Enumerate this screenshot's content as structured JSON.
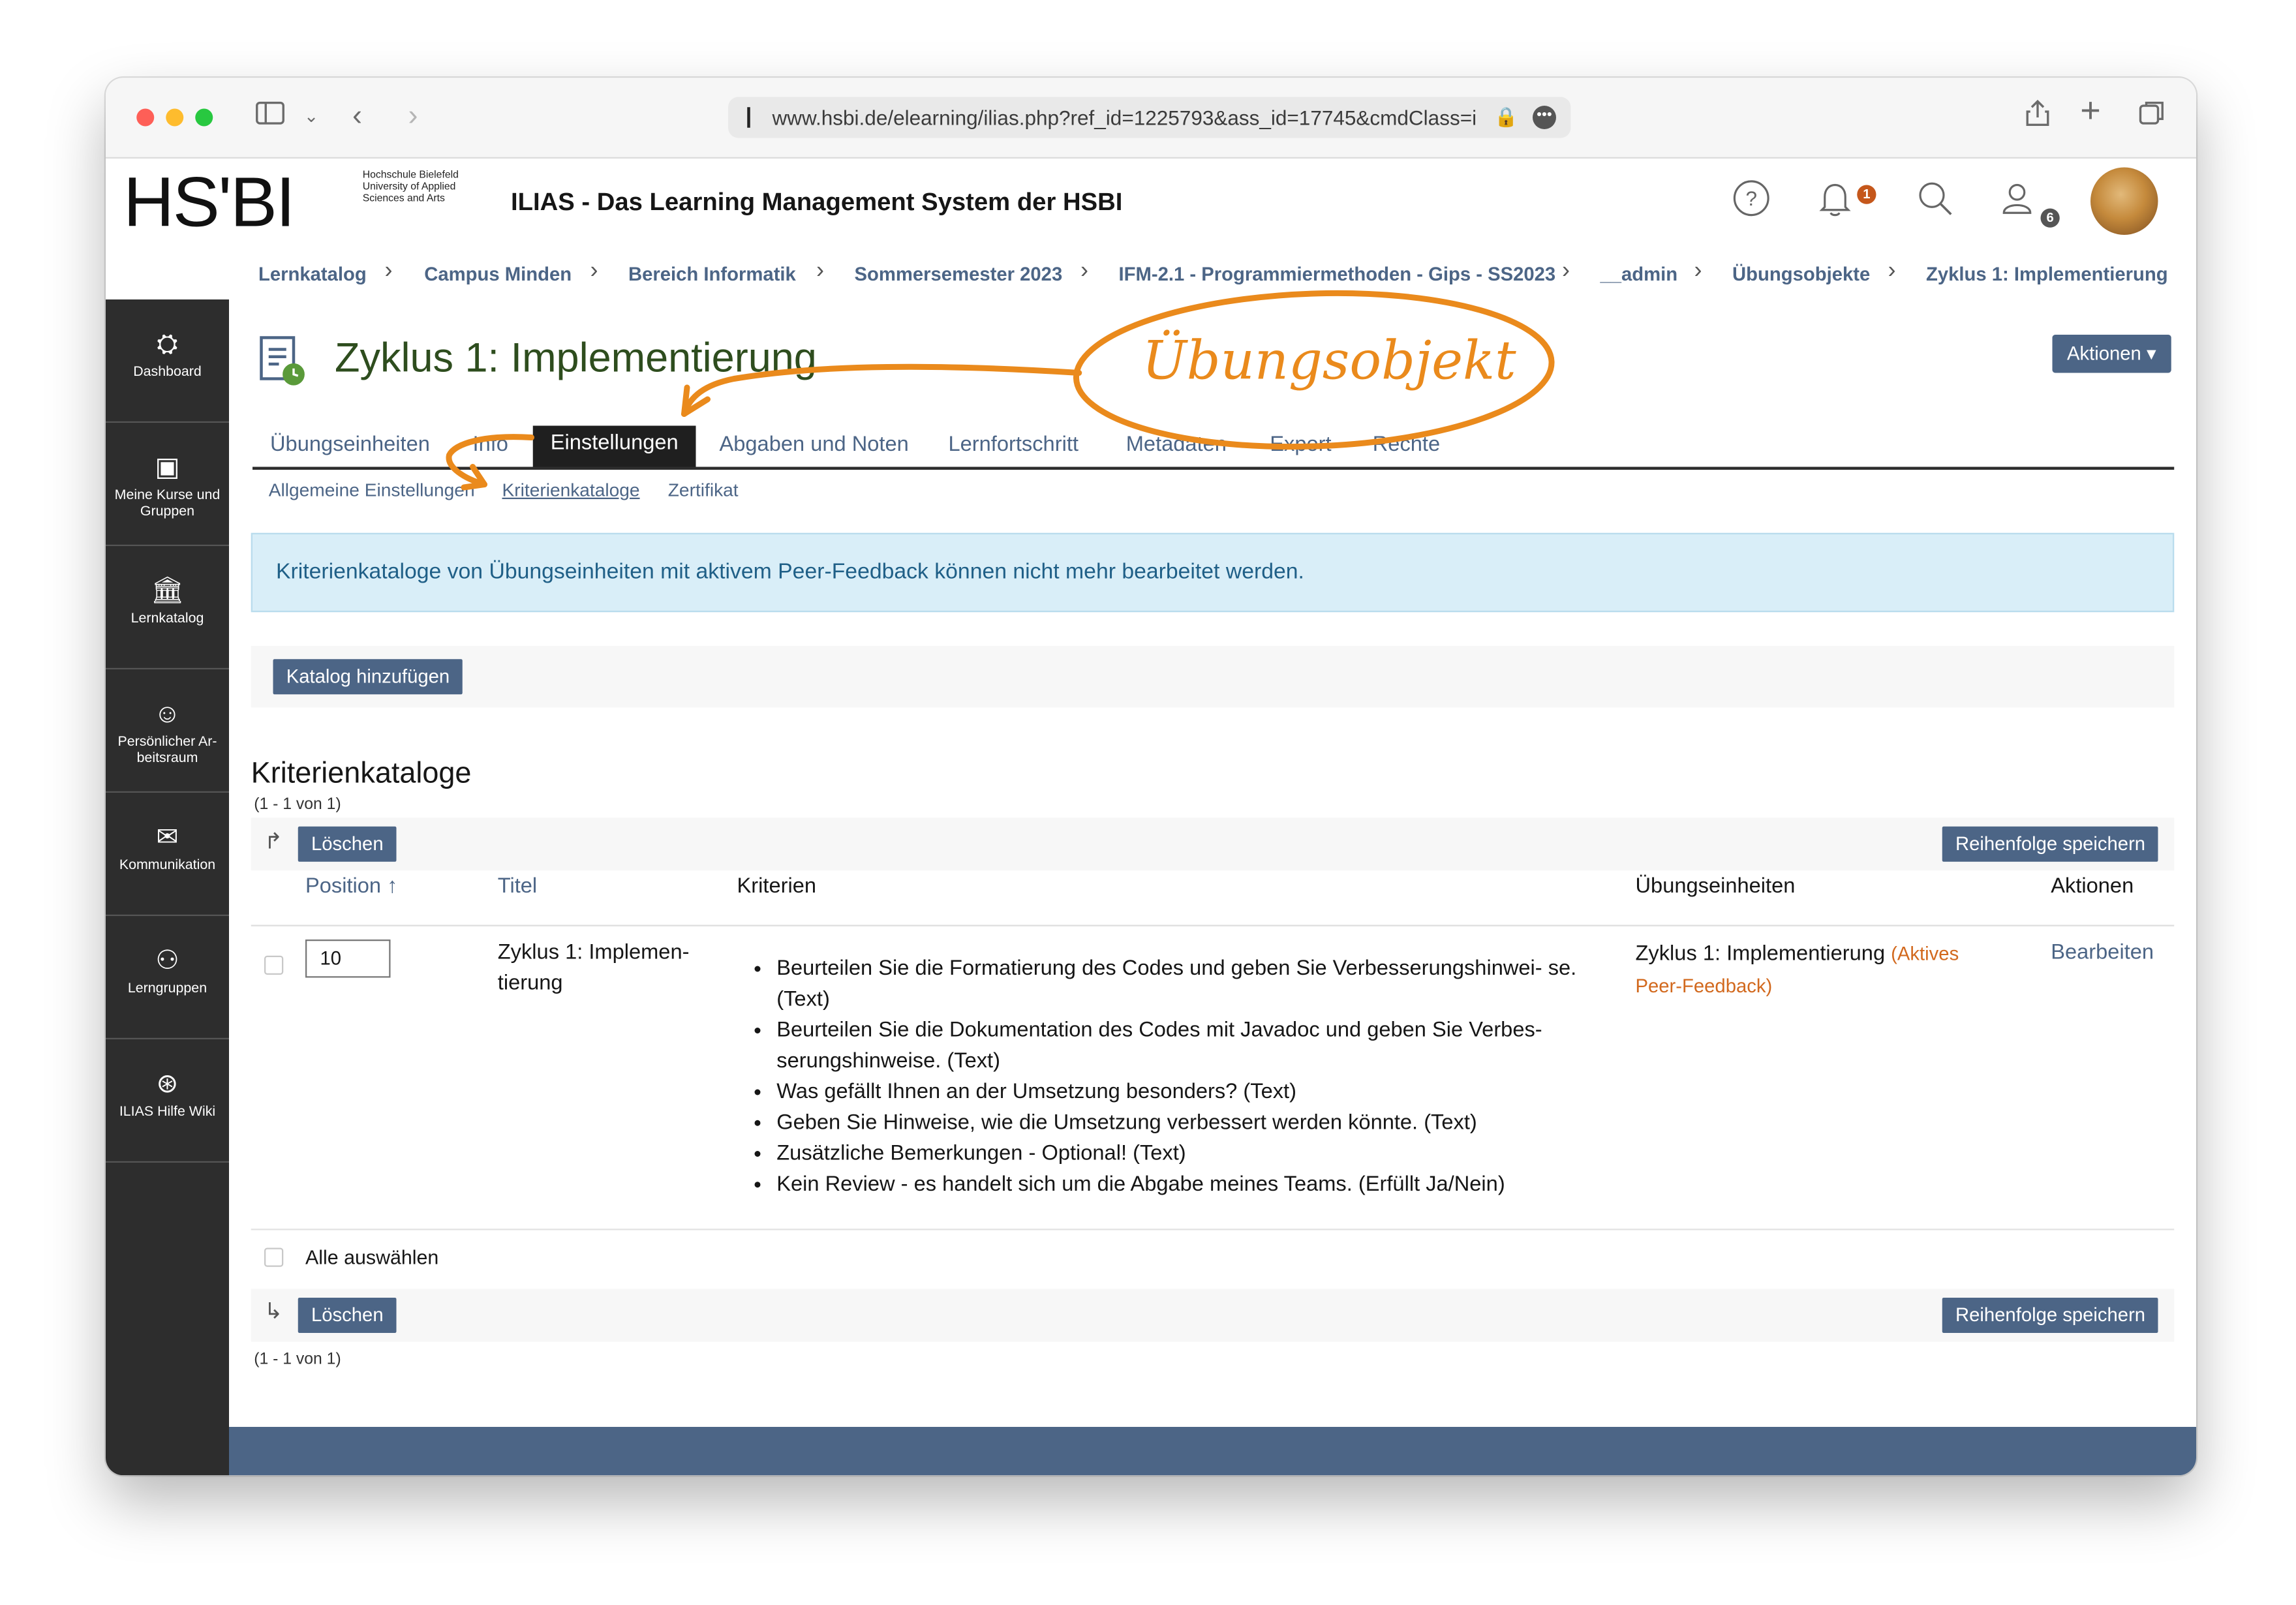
{
  "browser": {
    "url": "www.hsbi.de/elearning/ilias.php?ref_id=1225793&ass_id=17745&cmdClass=i"
  },
  "header": {
    "logo_text": "HS'BI",
    "logo_sub": "Hochschule Bielefeld University of Applied Sciences and Arts",
    "app_title": "ILIAS - Das Learning Management System der HSBI",
    "notification_count": "1",
    "user_count": "6"
  },
  "breadcrumb": [
    "Lernkatalog",
    "Campus Minden",
    "Bereich Informatik",
    "Sommersemester 2023",
    "IFM-2.1 - Programmiermethoden - Gips - SS2023",
    "__admin",
    "Übungsobjekte",
    "Zyklus 1: Implementierung"
  ],
  "sidebar": {
    "items": [
      {
        "label": "Dashboard"
      },
      {
        "label": "Meine Kurse und Gruppen"
      },
      {
        "label": "Lernkatalog"
      },
      {
        "label": "Persönlicher Ar- beitsraum"
      },
      {
        "label": "Kommunikation"
      },
      {
        "label": "Lerngruppen"
      },
      {
        "label": "ILIAS Hilfe Wiki"
      }
    ]
  },
  "page": {
    "title": "Zyklus 1: Implementierung",
    "actions_label": "Aktionen ▾"
  },
  "tabs": [
    {
      "label": "Übungseinheiten"
    },
    {
      "label": "Info"
    },
    {
      "label": "Einstellungen"
    },
    {
      "label": "Abgaben und Noten"
    },
    {
      "label": "Lernfortschritt"
    },
    {
      "label": "Metadaten"
    },
    {
      "label": "Export"
    },
    {
      "label": "Rechte"
    }
  ],
  "subtabs": [
    {
      "label": "Allgemeine Einstellungen"
    },
    {
      "label": "Kriterienkataloge"
    },
    {
      "label": "Zertifikat"
    }
  ],
  "info_message": "Kriterienkataloge von Übungseinheiten mit aktivem Peer-Feedback können nicht mehr bearbeitet werden.",
  "add_catalog_label": "Katalog hinzufügen",
  "table": {
    "title": "Kriterienkataloge",
    "count": "(1 - 1 von 1)",
    "delete_label": "Löschen",
    "save_order_label": "Reihenfolge speichern",
    "select_all_label": "Alle auswählen",
    "columns": {
      "position": "Position",
      "titel": "Titel",
      "kriterien": "Kriterien",
      "uebungseinheiten": "Übungseinheiten",
      "aktionen": "Aktionen"
    },
    "rows": [
      {
        "position": "10",
        "title_line1": "Zyklus 1: Implemen-",
        "title_line2": "tierung",
        "criteria": [
          "Beurteilen Sie die Formatierung des Codes und geben Sie Verbesserungshinwei- se. (Text)",
          "Beurteilen Sie die Dokumentation des Codes mit Javadoc und geben Sie Verbes- serungshinweise. (Text)",
          "Was gefällt Ihnen an der Umsetzung besonders? (Text)",
          "Geben Sie Hinweise, wie die Umsetzung verbessert werden könnte. (Text)",
          "Zusätzliche Bemerkungen - Optional! (Text)",
          "Kein Review - es handelt sich um die Abgabe meines Teams. (Erfüllt Ja/Nein)"
        ],
        "unit": "Zyklus 1: Implementierung",
        "unit_status_1": "(Aktives",
        "unit_status_2": "Peer-Feedback)",
        "action": "Bearbeiten"
      }
    ]
  },
  "annotation": {
    "label": "Übungsobjekt"
  },
  "colors": {
    "accent": "#4c6586",
    "title_green": "#2e4d1e",
    "annotation": "#ea8a1c",
    "status_orange": "#d2691e",
    "info_bg": "#d9eef8"
  }
}
